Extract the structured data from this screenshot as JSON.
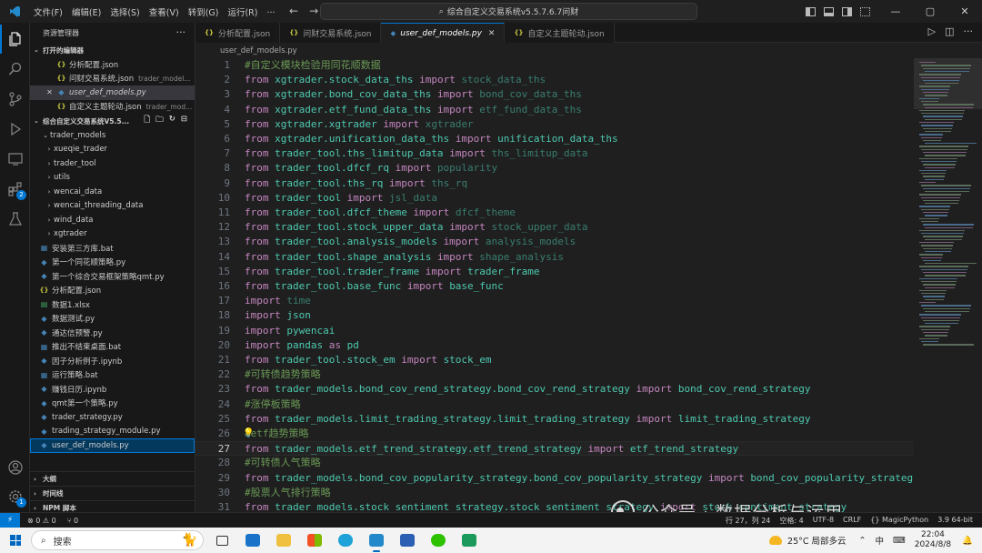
{
  "titlebar": {
    "menus": [
      "文件(F)",
      "编辑(E)",
      "选择(S)",
      "查看(V)",
      "转到(G)",
      "运行(R)",
      "..."
    ],
    "command_center": "综合自定义交易系统v5.5.7.6.7问财",
    "window_controls": [
      "—",
      "▢",
      "✕"
    ]
  },
  "activity_bar": {
    "icons": [
      "explorer-icon",
      "search-icon",
      "source-control-icon",
      "run-debug-icon",
      "remote-explorer-icon",
      "extensions-icon",
      "testing-icon",
      "account-icon",
      "settings-icon"
    ],
    "extensions_badge": "2",
    "settings_badge": "1"
  },
  "sidebar": {
    "title": "资源管理器",
    "open_editors_title": "打开的编辑器",
    "open_editors": [
      {
        "name": "分析配置.json",
        "type": "json",
        "desc": ""
      },
      {
        "name": "问财交易系统.json",
        "type": "json",
        "desc": "trader_model..."
      },
      {
        "name": "user_def_models.py",
        "type": "py",
        "desc": ""
      },
      {
        "name": "自定义主题轮动.json",
        "type": "json",
        "desc": "trader_mod..."
      }
    ],
    "workspace_title": "综合自定义交易系统V5.5...",
    "tree": [
      {
        "name": "trader_models",
        "kind": "folder",
        "open": true,
        "indent": 1
      },
      {
        "name": "xueqie_trader",
        "kind": "folder",
        "open": false,
        "indent": 1
      },
      {
        "name": "trader_tool",
        "kind": "folder",
        "open": false,
        "indent": 1
      },
      {
        "name": "utils",
        "kind": "folder",
        "open": false,
        "indent": 1
      },
      {
        "name": "wencai_data",
        "kind": "folder",
        "open": false,
        "indent": 1
      },
      {
        "name": "wencai_threading_data",
        "kind": "folder",
        "open": false,
        "indent": 1
      },
      {
        "name": "wind_data",
        "kind": "folder",
        "open": false,
        "indent": 1
      },
      {
        "name": "xgtrader",
        "kind": "folder",
        "open": false,
        "indent": 1
      },
      {
        "name": "安装第三方库.bat",
        "kind": "bat"
      },
      {
        "name": "第一个同花顺策略.py",
        "kind": "py"
      },
      {
        "name": "第一个综合交易框架策略qmt.py",
        "kind": "py"
      },
      {
        "name": "分析配置.json",
        "kind": "json"
      },
      {
        "name": "数据1.xlsx",
        "kind": "xlsx"
      },
      {
        "name": "数据测试.py",
        "kind": "py"
      },
      {
        "name": "通达信预警.py",
        "kind": "py"
      },
      {
        "name": "推出不结束桌面.bat",
        "kind": "bat"
      },
      {
        "name": "因子分析例子.ipynb",
        "kind": "ipynb"
      },
      {
        "name": "运行策略.bat",
        "kind": "bat"
      },
      {
        "name": "赚钱日历.ipynb",
        "kind": "ipynb"
      },
      {
        "name": "qmt第一个策略.py",
        "kind": "py"
      },
      {
        "name": "trader_strategy.py",
        "kind": "py"
      },
      {
        "name": "trading_strategy_module.py",
        "kind": "py"
      },
      {
        "name": "user_def_models.py",
        "kind": "py"
      }
    ],
    "bottom_sections": [
      "大纲",
      "时间线",
      "NPM 脚本"
    ]
  },
  "tabs": [
    {
      "label": "分析配置.json",
      "type": "json",
      "active": false
    },
    {
      "label": "问财交易系统.json",
      "type": "json",
      "active": false
    },
    {
      "label": "user_def_models.py",
      "type": "py",
      "active": true
    },
    {
      "label": "自定义主题轮动.json",
      "type": "json",
      "active": false
    }
  ],
  "breadcrumb": "user_def_models.py",
  "editor": {
    "current_line": 27,
    "lines": [
      {
        "n": "1",
        "t": [
          [
            "cm",
            "#自定义模块检验用同花顺数据"
          ]
        ]
      },
      {
        "n": "2",
        "t": [
          [
            "kw",
            "from "
          ],
          [
            "mod",
            "xgtrader.stock_data_ths "
          ],
          [
            "kw",
            "import "
          ],
          [
            "dim",
            "stock_data_ths"
          ]
        ]
      },
      {
        "n": "3",
        "t": [
          [
            "kw",
            "from "
          ],
          [
            "mod",
            "xgtrader.bond_cov_data_ths "
          ],
          [
            "kw",
            "import "
          ],
          [
            "dim",
            "bond_cov_data_ths"
          ]
        ]
      },
      {
        "n": "4",
        "t": [
          [
            "kw",
            "from "
          ],
          [
            "mod",
            "xgtrader.etf_fund_data_ths "
          ],
          [
            "kw",
            "import "
          ],
          [
            "dim",
            "etf_fund_data_ths"
          ]
        ]
      },
      {
        "n": "5",
        "t": [
          [
            "kw",
            "from "
          ],
          [
            "mod",
            "xgtrader.xgtrader "
          ],
          [
            "kw",
            "import "
          ],
          [
            "dim",
            "xgtrader"
          ]
        ]
      },
      {
        "n": "6",
        "t": [
          [
            "kw",
            "from "
          ],
          [
            "mod",
            "xgtrader.unification_data_ths "
          ],
          [
            "kw",
            "import "
          ],
          [
            "mod",
            "unification_data_ths"
          ]
        ]
      },
      {
        "n": "7",
        "t": [
          [
            "kw",
            "from "
          ],
          [
            "mod",
            "trader_tool.ths_limitup_data "
          ],
          [
            "kw",
            "import "
          ],
          [
            "dim",
            "ths_limitup_data"
          ]
        ]
      },
      {
        "n": "8",
        "t": [
          [
            "kw",
            "from "
          ],
          [
            "mod",
            "trader_tool.dfcf_rq "
          ],
          [
            "kw",
            "import "
          ],
          [
            "dim",
            "popularity"
          ]
        ]
      },
      {
        "n": "9",
        "t": [
          [
            "kw",
            "from "
          ],
          [
            "mod",
            "trader_tool.ths_rq "
          ],
          [
            "kw",
            "import "
          ],
          [
            "dim",
            "ths_rq"
          ]
        ]
      },
      {
        "n": "10",
        "t": [
          [
            "kw",
            "from "
          ],
          [
            "mod",
            "trader_tool "
          ],
          [
            "kw",
            "import "
          ],
          [
            "dim",
            "jsl_data"
          ]
        ]
      },
      {
        "n": "11",
        "t": [
          [
            "kw",
            "from "
          ],
          [
            "mod",
            "trader_tool.dfcf_theme "
          ],
          [
            "kw",
            "import "
          ],
          [
            "dim",
            "dfcf_theme"
          ]
        ]
      },
      {
        "n": "12",
        "t": [
          [
            "kw",
            "from "
          ],
          [
            "mod",
            "trader_tool.stock_upper_data "
          ],
          [
            "kw",
            "import "
          ],
          [
            "dim",
            "stock_upper_data"
          ]
        ]
      },
      {
        "n": "13",
        "t": [
          [
            "kw",
            "from "
          ],
          [
            "mod",
            "trader_tool.analysis_models "
          ],
          [
            "kw",
            "import "
          ],
          [
            "dim",
            "analysis_models"
          ]
        ]
      },
      {
        "n": "14",
        "t": [
          [
            "kw",
            "from "
          ],
          [
            "mod",
            "trader_tool.shape_analysis "
          ],
          [
            "kw",
            "import "
          ],
          [
            "dim",
            "shape_analysis"
          ]
        ]
      },
      {
        "n": "15",
        "t": [
          [
            "kw",
            "from "
          ],
          [
            "mod",
            "trader_tool.trader_frame "
          ],
          [
            "kw",
            "import "
          ],
          [
            "mod",
            "trader_frame"
          ]
        ]
      },
      {
        "n": "16",
        "t": [
          [
            "kw",
            "from "
          ],
          [
            "mod",
            "trader_tool.base_func "
          ],
          [
            "kw",
            "import "
          ],
          [
            "mod",
            "base_func"
          ]
        ]
      },
      {
        "n": "17",
        "t": [
          [
            "kw",
            "import "
          ],
          [
            "dim",
            "time"
          ]
        ]
      },
      {
        "n": "18",
        "t": [
          [
            "kw",
            "import "
          ],
          [
            "mod",
            "json"
          ]
        ]
      },
      {
        "n": "19",
        "t": [
          [
            "kw",
            "import "
          ],
          [
            "mod",
            "pywencai"
          ]
        ]
      },
      {
        "n": "20",
        "t": [
          [
            "kw",
            "import "
          ],
          [
            "mod",
            "pandas "
          ],
          [
            "kw",
            "as "
          ],
          [
            "mod",
            "pd"
          ]
        ]
      },
      {
        "n": "21",
        "t": [
          [
            "kw",
            "from "
          ],
          [
            "mod",
            "trader_tool.stock_em "
          ],
          [
            "kw",
            "import "
          ],
          [
            "mod",
            "stock_em"
          ]
        ]
      },
      {
        "n": "22",
        "t": [
          [
            "cm",
            "#可转债趋势策略"
          ]
        ]
      },
      {
        "n": "23",
        "t": [
          [
            "kw",
            "from "
          ],
          [
            "mod",
            "trader_models.bond_cov_rend_strategy.bond_cov_rend_strategy "
          ],
          [
            "kw",
            "import "
          ],
          [
            "mod",
            "bond_cov_rend_strategy"
          ]
        ]
      },
      {
        "n": "24",
        "t": [
          [
            "cm",
            "#涨停板策略"
          ]
        ]
      },
      {
        "n": "25",
        "t": [
          [
            "kw",
            "from "
          ],
          [
            "mod",
            "trader_models.limit_trading_strategy.limit_trading_strategy "
          ],
          [
            "kw",
            "import "
          ],
          [
            "mod",
            "limit_trading_strategy"
          ]
        ]
      },
      {
        "n": "26",
        "t": [
          [
            "cm",
            "#etf趋势策略"
          ]
        ]
      },
      {
        "n": "27",
        "t": [
          [
            "kw",
            "from "
          ],
          [
            "mod",
            "trader_models.etf_trend_strategy.etf_trend_strategy "
          ],
          [
            "kw",
            "import "
          ],
          [
            "mod",
            "etf_trend_strategy"
          ]
        ]
      },
      {
        "n": "28",
        "t": [
          [
            "cm",
            "#可转债人气策略"
          ]
        ]
      },
      {
        "n": "29",
        "t": [
          [
            "kw",
            "from "
          ],
          [
            "mod",
            "trader_models.bond_cov_popularity_strategy.bond_cov_popularity_strategy "
          ],
          [
            "kw",
            "import "
          ],
          [
            "mod",
            "bond_cov_popularity_strategy"
          ]
        ]
      },
      {
        "n": "30",
        "t": [
          [
            "cm",
            "#股票人气排行策略"
          ]
        ]
      },
      {
        "n": "31",
        "t": [
          [
            "kw",
            "from "
          ],
          [
            "mod",
            "trader_models.stock_sentiment_strategy.stock_sentiment_strategy "
          ],
          [
            "kw",
            "import "
          ],
          [
            "mod",
            "stock_sentiment_strategy"
          ]
        ]
      }
    ]
  },
  "statusbar": {
    "errors": "⊗ 0 ⚠ 0",
    "ports": "⑂ 0",
    "position": "行 27，列 24",
    "spaces": "空格: 4",
    "encoding": "UTF-8",
    "eol": "CRLF",
    "language": "{} MagicPython",
    "version": "3.9 64-bit"
  },
  "watermark": "公众号 · 数据分析与运用",
  "taskbar": {
    "search_placeholder": "搜索",
    "weather": "25°C 局部多云",
    "ime": "中",
    "time": "22:04",
    "date": "2024/8/8"
  },
  "colors": {
    "accent": "#0078d4",
    "keyword": "#c586c0",
    "module": "#4ec9b0",
    "comment": "#6a9955"
  }
}
